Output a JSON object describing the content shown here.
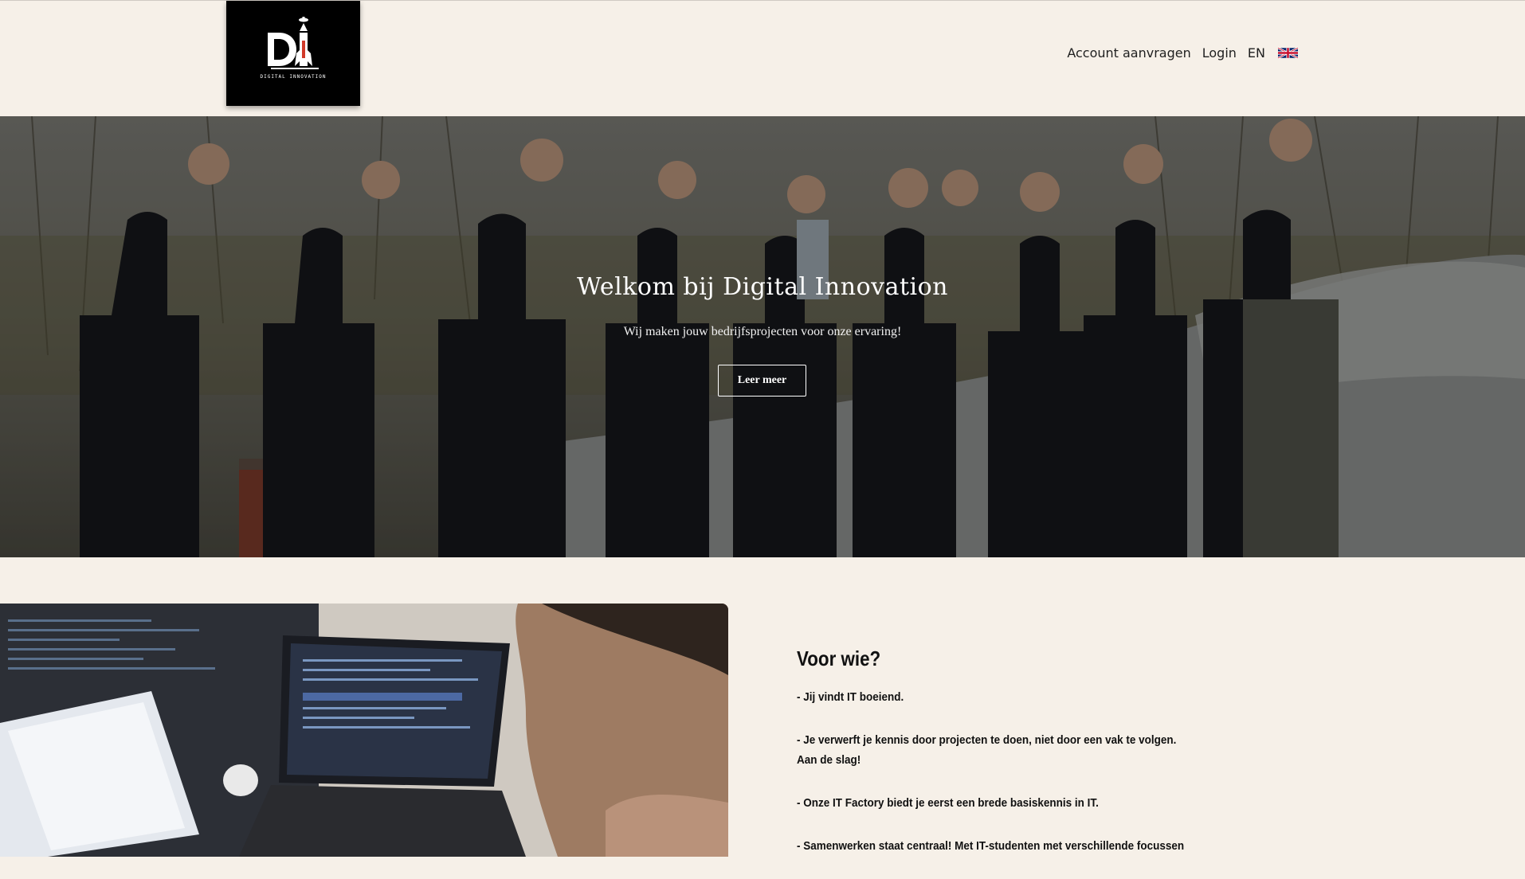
{
  "header": {
    "logo": {
      "letters": "DI",
      "subtitle": "DIGITAL INNOVATION"
    },
    "nav": {
      "account_label": "Account aanvragen",
      "login_label": "Login",
      "language_label": "EN",
      "flag_icon": "uk-flag-icon"
    }
  },
  "hero": {
    "title": "Welkom bij Digital Innovation",
    "subtitle": "Wij maken jouw bedrijfsprojecten voor onze ervaring!",
    "button_label": "Leer meer"
  },
  "section": {
    "title": "Voor wie?",
    "bullets": [
      "- Jij vindt IT boeiend.",
      "- Je verwerft je kennis door projecten te doen, niet door een vak te volgen.",
      "Aan de slag!",
      "- Onze IT Factory biedt je eerst een brede basiskennis in IT.",
      "- Samenwerken staat centraal! Met IT-studenten met verschillende focussen"
    ]
  },
  "colors": {
    "background": "#f6f0e8",
    "logo_background": "#000000",
    "text": "#1f1f1f"
  }
}
